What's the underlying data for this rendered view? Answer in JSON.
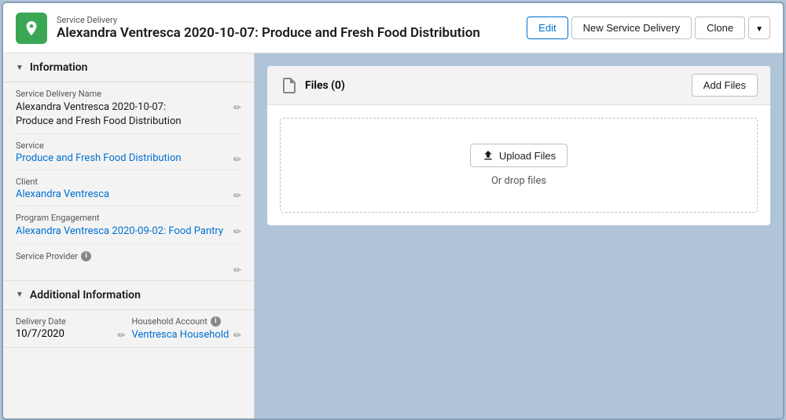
{
  "header": {
    "subtitle": "Service Delivery",
    "title": "Alexandra Ventresca 2020-10-07: Produce and Fresh Food Distribution",
    "edit_label": "Edit",
    "new_label": "New Service Delivery",
    "clone_label": "Clone"
  },
  "information_section": {
    "label": "Information",
    "fields": [
      {
        "label": "Service Delivery Name",
        "value": "Alexandra Ventresca 2020-10-07: Produce and Fresh Food Distribution",
        "type": "text"
      },
      {
        "label": "Service",
        "value": "Produce and Fresh Food Distribution",
        "type": "link"
      },
      {
        "label": "Client",
        "value": "Alexandra Ventresca",
        "type": "link"
      },
      {
        "label": "Program Engagement",
        "value": "Alexandra Ventresca 2020-09-02: Food Pantry",
        "type": "link"
      },
      {
        "label": "Service Provider",
        "value": "",
        "type": "info"
      }
    ]
  },
  "additional_section": {
    "label": "Additional Information",
    "delivery_date_label": "Delivery Date",
    "delivery_date_value": "10/7/2020",
    "household_account_label": "Household Account",
    "household_account_value": "Ventresca Household"
  },
  "files_section": {
    "title": "Files (0)",
    "add_files_label": "Add Files",
    "upload_label": "Upload Files",
    "drop_text": "Or drop files"
  }
}
